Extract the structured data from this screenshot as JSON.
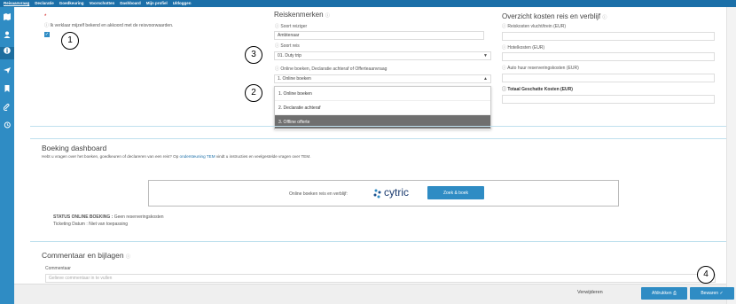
{
  "nav": {
    "items": [
      "Reisaanvraag",
      "Declaratie",
      "Goedkeuring",
      "Voorschotten",
      "Dashboard",
      "Mijn profiel",
      "Uitloggen"
    ]
  },
  "sidebar": {
    "icons": [
      "map-icon",
      "user-icon",
      "info-icon",
      "plane-icon",
      "bookmark-icon",
      "paperclip-icon",
      "history-icon"
    ]
  },
  "top": {
    "asterisk": "*",
    "declaration": "Ik verklaar mijzelf bekend en akkoord met de reisvoorwaarden."
  },
  "reiskenmerken": {
    "title": "Reiskenmerken",
    "soort_reiziger_label": "Soort reiziger",
    "soort_reiziger_value": "Ambtenaar",
    "soort_reis_label": "Soort reis",
    "soort_reis_value": "01. Duty trip",
    "boeken_label": "Online boeken, Declaratie achteraf of Offerteaanvraag",
    "boeken_value": "1. Online boeken",
    "options": [
      "1. Online boeken",
      "2. Declaratie achteraf",
      "3. Offline offerte"
    ]
  },
  "kosten": {
    "title": "Overzicht kosten reis en verblijf",
    "reiskosten_label": "Reiskosten vlucht/trein (EUR)",
    "hotel_label": "Hotelkosten (EUR)",
    "auto_label": "Auto huur reserveringskosten (EUR)",
    "totaal_label": "Totaal Geschatte Kosten (EUR)"
  },
  "dashboard": {
    "title": "Boeking dashboard",
    "help_pre": "Hebt u vragen over het boeken, goedkeuren of declareren van een reis? Op",
    "help_link": "ondersteuning TEM",
    "help_post": "vindt u instructies en veelgestelde vragen over TEM.",
    "online_text": "Online boeken reis en verblijf:",
    "cytric_logo": "cytric",
    "book_button": "Zoek & boek",
    "status_label": "STATUS ONLINE BOEKING :",
    "status_value": "Geen reserveringskosten",
    "ticketing": "Ticketing Datum : Niet van toepassing"
  },
  "commentaar": {
    "title": "Commentaar en bijlagen",
    "label": "Commentaar",
    "placeholder": "Gelieve commentaar in te vullen"
  },
  "footer": {
    "delete": "Verwijderen",
    "print": "Afdrukken",
    "save": "Bewaren"
  },
  "annotations": [
    "1",
    "2",
    "3",
    "4"
  ],
  "colors": {
    "nav_bg": "#1b6fa8",
    "sidebar_bg": "#2f8cc4",
    "button_blue": "#2f8cc4",
    "selected_option": "#6f6f6f"
  }
}
